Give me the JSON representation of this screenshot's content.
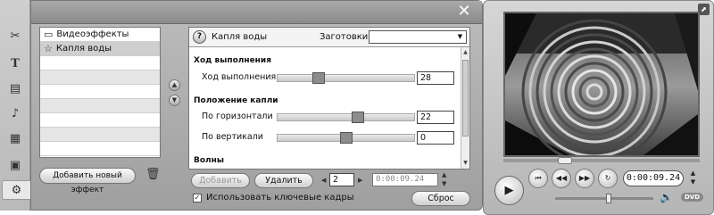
{
  "window": {
    "close_icon": "close-x-icon"
  },
  "tools": [
    {
      "name": "tool-video-effects-icon",
      "glyph": "✂"
    },
    {
      "name": "tool-title-icon",
      "glyph": "T"
    },
    {
      "name": "tool-menu-icon",
      "glyph": "▤"
    },
    {
      "name": "tool-audio-icon",
      "glyph": "♪"
    },
    {
      "name": "tool-clapper-icon",
      "glyph": "🎬"
    },
    {
      "name": "tool-square-icon",
      "glyph": "▣"
    },
    {
      "name": "tool-effects-icon",
      "glyph": "⚙"
    }
  ],
  "effects_list": {
    "items": [
      {
        "label": "Видеоэффекты",
        "icon": "folder-icon"
      },
      {
        "label": "Капля воды",
        "icon": "star-icon"
      }
    ],
    "add_button": "Добавить новый эффект",
    "delete_icon": "trash-icon"
  },
  "settings": {
    "effect_name": "Капля воды",
    "help_label": "?",
    "presets_label": "Заготовки:",
    "presets_value": "",
    "sections": [
      {
        "title": "Ход выполнения"
      },
      {
        "title": "Положение капли"
      },
      {
        "title": "Волны"
      }
    ],
    "params": [
      {
        "label": "Ход выполнения",
        "value": "28",
        "level": 0.28
      },
      {
        "label": "По горизонтали",
        "value": "22",
        "level": 0.6
      },
      {
        "label": "По вертикали",
        "value": "0",
        "level": 0.5
      }
    ]
  },
  "controls": {
    "add_button": "Добавить",
    "delete_button": "Удалить",
    "frame_value": "2",
    "time_value": "0:00:09.24",
    "keyframes_label": "Использовать ключевые кадры",
    "keyframes_checked": true,
    "reset_button": "Сброс"
  },
  "preview": {
    "timecode": "0:00:09.24",
    "scrub_position": 0.3,
    "volume_level": 0.55
  }
}
